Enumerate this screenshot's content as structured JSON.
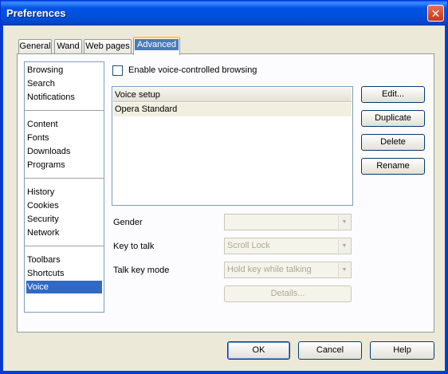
{
  "window": {
    "title": "Preferences",
    "close_icon": "close-icon"
  },
  "tabs": [
    {
      "label": "General",
      "active": false
    },
    {
      "label": "Wand",
      "active": false
    },
    {
      "label": "Web pages",
      "active": false
    },
    {
      "label": "Advanced",
      "active": true
    }
  ],
  "categories": {
    "groups": [
      [
        "Browsing",
        "Search",
        "Notifications"
      ],
      [
        "Content",
        "Fonts",
        "Downloads",
        "Programs"
      ],
      [
        "History",
        "Cookies",
        "Security",
        "Network"
      ],
      [
        "Toolbars",
        "Shortcuts",
        "Voice"
      ]
    ],
    "selected": "Voice"
  },
  "voice": {
    "enable_label": "Enable voice-controlled browsing",
    "enable_checked": false,
    "list_header": "Voice setup",
    "list_items": [
      "Opera Standard"
    ],
    "buttons": {
      "edit": "Edit...",
      "duplicate": "Duplicate",
      "delete": "Delete",
      "rename": "Rename"
    },
    "gender_label": "Gender",
    "gender_value": "",
    "key_to_talk_label": "Key to talk",
    "key_to_talk_value": "Scroll Lock",
    "talk_key_mode_label": "Talk key mode",
    "talk_key_mode_value": "Hold key while talking",
    "details_label": "Details..."
  },
  "footer": {
    "ok": "OK",
    "cancel": "Cancel",
    "help": "Help"
  }
}
